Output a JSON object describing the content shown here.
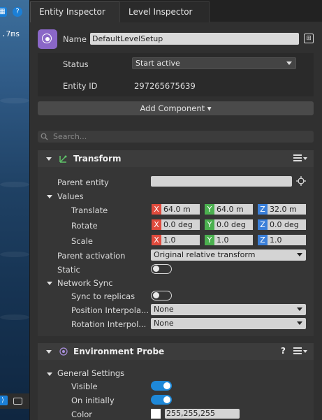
{
  "viewport": {
    "readout": ".7ms",
    "top_icons": [
      "grid-icon",
      "help-icon"
    ],
    "bottom_icons": [
      "camera-icon",
      "vr-icon"
    ]
  },
  "tabs": [
    {
      "label": "Entity Inspector",
      "active": true
    },
    {
      "label": "Level Inspector",
      "active": false
    }
  ],
  "entity": {
    "name_label": "Name",
    "name_value": "DefaultLevelSetup",
    "status_label": "Status",
    "status_value": "Start active",
    "id_label": "Entity ID",
    "id_value": "297265675639"
  },
  "add_component": {
    "label": "Add Component ▾"
  },
  "search": {
    "placeholder": "Search..."
  },
  "transform": {
    "title": "Transform",
    "parent_entity_label": "Parent entity",
    "values_label": "Values",
    "translate": {
      "label": "Translate",
      "x": "64.0 m",
      "y": "64.0 m",
      "z": "32.0 m"
    },
    "rotate": {
      "label": "Rotate",
      "x": "0.0 deg",
      "y": "0.0 deg",
      "z": "0.0 deg"
    },
    "scale": {
      "label": "Scale",
      "x": "1.0",
      "y": "1.0",
      "z": "1.0"
    },
    "axis_labels": {
      "x": "X",
      "y": "Y",
      "z": "Z"
    },
    "parent_activation_label": "Parent activation",
    "parent_activation_value": "Original relative transform",
    "static_label": "Static",
    "static_on": false,
    "network_sync_label": "Network Sync",
    "sync_to_replicas_label": "Sync to replicas",
    "sync_to_replicas_on": false,
    "position_interp_label": "Position Interpola...",
    "position_interp_value": "None",
    "rotation_interp_label": "Rotation Interpol...",
    "rotation_interp_value": "None"
  },
  "env_probe": {
    "title": "Environment Probe",
    "help_label": "?",
    "general_settings_label": "General Settings",
    "visible_label": "Visible",
    "visible_on": true,
    "on_initially_label": "On initially",
    "on_initially_on": true,
    "color_label": "Color",
    "color_value": "255,255,255"
  },
  "colors": {
    "accent": "#1e88d8",
    "entity_icon": "#8a67c7",
    "axis_x": "#e04b3d",
    "axis_y": "#4bb04f",
    "axis_z": "#3a7fd9"
  }
}
